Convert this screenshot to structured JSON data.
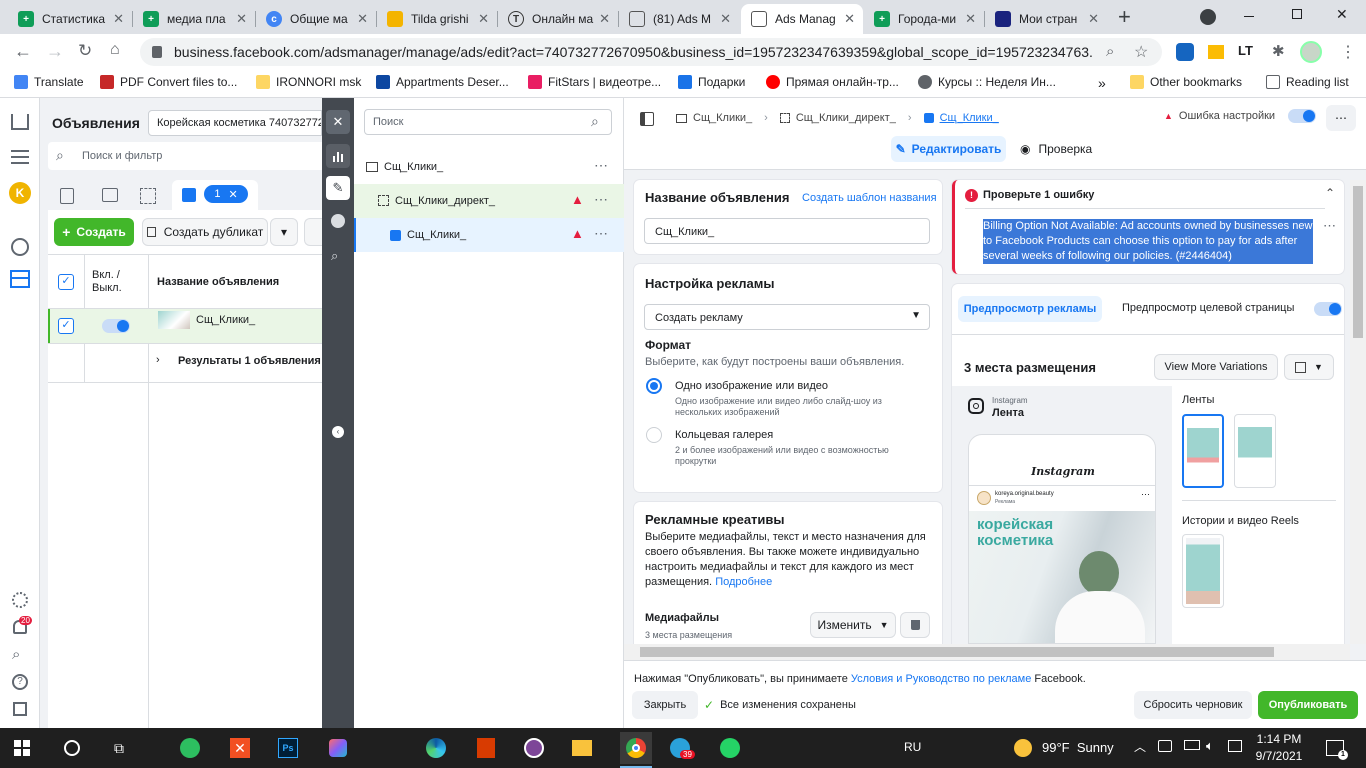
{
  "browser": {
    "tabs": [
      {
        "title": "Статистика",
        "color": "#0f9d58"
      },
      {
        "title": "медиа пла",
        "color": "#0f9d58"
      },
      {
        "title": "Общие ма",
        "color": "#4285f4"
      },
      {
        "title": "Tilda grishi",
        "color": "#f4b400"
      },
      {
        "title": "Онлайн ма",
        "color": "#5f6368"
      },
      {
        "title": "(81) Ads M",
        "color": "#5f6368"
      },
      {
        "title": "Ads Manag",
        "color": "#5f6368"
      },
      {
        "title": "Города-ми",
        "color": "#0f9d58"
      },
      {
        "title": "Мои стран",
        "color": "#1a237e"
      }
    ],
    "url": "business.facebook.com/adsmanager/manage/ads/edit?act=740732772670950&business_id=1957232347639359&global_scope_id=195723234763...",
    "bookmarks": [
      "Translate",
      "PDF Convert files to...",
      "IRONNORI msk",
      "Appartments Deser...",
      "FitStars | видеотре...",
      "Подарки",
      "Прямая онлайн-тр...",
      "Курсы :: Неделя Ин..."
    ],
    "other_bookmarks": "Other bookmarks",
    "reading_list": "Reading list"
  },
  "list": {
    "title": "Объявления",
    "campaign": "Корейская косметика 7407327726",
    "search_placeholder": "Поиск и фильтр",
    "selection_count": "1",
    "create": "Создать",
    "duplicate": "Создать дубликат",
    "col_toggle": "Вкл. / Выкл.",
    "col_name": "Название объявления",
    "row_name": "Сщ_Клики_",
    "results": "Результаты 1 объявления"
  },
  "tree": {
    "search_placeholder": "Поиск",
    "items": [
      "Сщ_Клики_",
      "Сщ_Клики_директ_",
      "Сщ_Клики_"
    ]
  },
  "editor": {
    "breadcrumb": [
      "Сщ_Клики_",
      "Сщ_Клики_директ_",
      "Сщ_Клики_"
    ],
    "error_status": "Ошибка настройки",
    "edit": "Редактировать",
    "review": "Проверка",
    "ad_name_label": "Название объявления",
    "name_template": "Создать шаблон названия",
    "ad_name_value": "Сщ_Клики_",
    "setup_title": "Настройка рекламы",
    "setup_select": "Создать рекламу",
    "format_title": "Формат",
    "format_sub": "Выберите, как будут построены ваши объявления.",
    "opt1": "Одно изображение или видео",
    "opt1_sub": "Одно изображение или видео либо слайд-шоу из нескольких изображений",
    "opt2": "Кольцевая галерея",
    "opt2_sub": "2 и более изображений или видео с возможностью прокрутки",
    "creatives_title": "Рекламные креативы",
    "creatives_text": "Выберите медиафайлы, текст и место назначения для своего объявления. Вы также можете индивидуально настроить медиафайлы и текст для каждого из мест размещения.",
    "more": "Подробнее",
    "media_title": "Медиафайлы",
    "media_sub": "3 места размещения",
    "change": "Изменить",
    "error_title": "Проверьте 1 ошибку",
    "error_text": "Billing Option Not Available: Ad accounts owned by businesses new to Facebook Products can choose this option to pay for ads after several weeks of following our policies. (#2446404)",
    "preview_tab": "Предпросмотр рекламы",
    "landing_tab": "Предпросмотр целевой страницы",
    "placements": "3 места размещения",
    "variations": "View More Variations",
    "ig_label": "Instagram",
    "feed": "Лента",
    "ig_logo": "Instagram",
    "ig_account": "koreya.original.beauty",
    "ig_sponsored": "Реклама",
    "ad_text": "корейская косметика",
    "feeds_title": "Ленты",
    "stories_title": "Истории и видео Reels",
    "footer_terms_pre": "Нажимая \"Опубликовать\", вы принимаете ",
    "footer_terms_link": "Условия и Руководство по рекламе",
    "footer_terms_post": " Facebook.",
    "close": "Закрыть",
    "saved": "Все изменения сохранены",
    "discard": "Сбросить черновик",
    "publish": "Опубликовать"
  },
  "notifications_count": "20",
  "taskbar": {
    "lang": "RU",
    "weather": "99°F  Sunny",
    "time": "1:14 PM",
    "date": "9/7/2021",
    "badge": "39"
  }
}
